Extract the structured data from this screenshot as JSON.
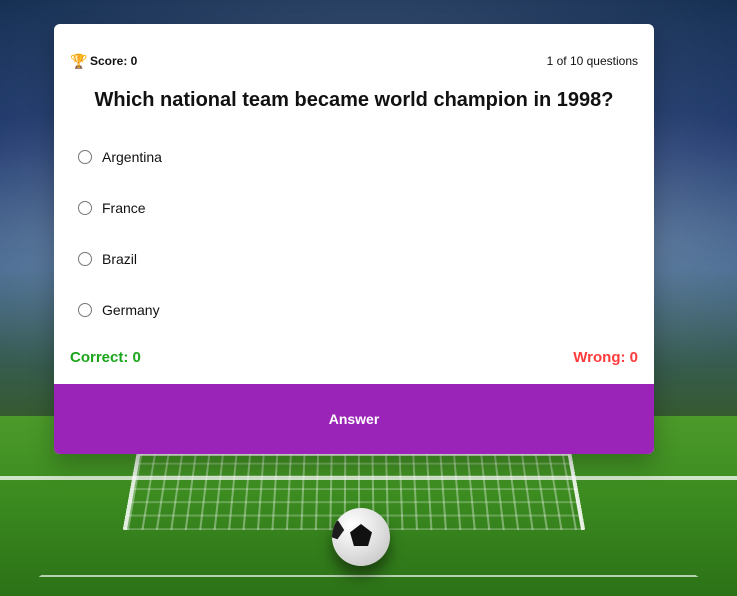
{
  "quiz": {
    "score_label": "Score: 0",
    "progress_label": "1 of 10 questions",
    "question": "Which national team became world champion in 1998?",
    "options": [
      {
        "label": "Argentina"
      },
      {
        "label": "France"
      },
      {
        "label": "Brazil"
      },
      {
        "label": "Germany"
      }
    ],
    "correct_label": "Correct: 0",
    "wrong_label": "Wrong: 0",
    "answer_button_label": "Answer"
  },
  "icons": {
    "trophy": "trophy-icon"
  },
  "colors": {
    "accent_purple": "#9b24b8",
    "correct_green": "#1aa51a",
    "wrong_red": "#ff3b3b"
  }
}
